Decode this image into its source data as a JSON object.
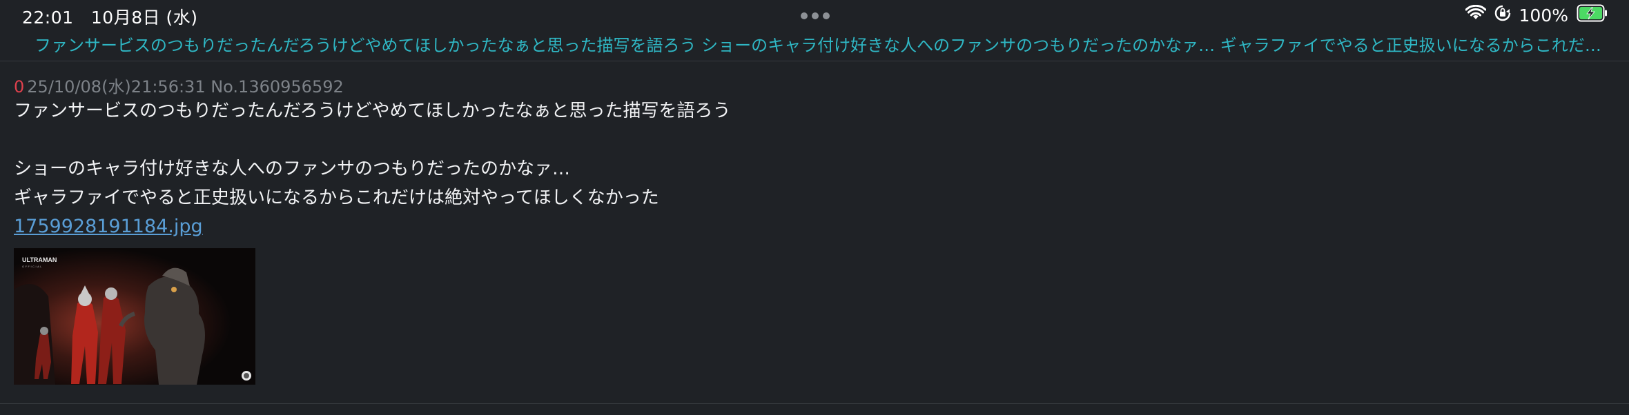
{
  "status_bar": {
    "time": "22:01",
    "date": "10月8日 (水)",
    "battery_percent": "100%",
    "icons": [
      "wifi-icon",
      "orientation-lock-icon",
      "battery-charging-icon"
    ]
  },
  "thread": {
    "title": "ファンサービスのつもりだったんだろうけどやめてほしかったなぁと思った描写を語ろう  ショーのキャラ付け好きな人へのファンサのつもりだったのかなァ… ギャラファイでやると正史扱いになるからこれだけは絶対やっ…"
  },
  "post": {
    "number": "0",
    "header": "25/10/08(水)21:56:31 No.1360956592",
    "body_lines": [
      "ファンサービスのつもりだったんだろうけどやめてほしかったなぁと思った描写を語ろう",
      "",
      "ショーのキャラ付け好きな人へのファンサのつもりだったのかなァ…",
      "ギャラファイでやると正史扱いになるからこれだけは絶対やってほしくなかった"
    ],
    "file_name": "1759928191184.jpg",
    "thumbnail": {
      "logo_text": "ULTRAMAN",
      "logo_sub": "OFFICIAL"
    }
  },
  "colors": {
    "background": "#1f2226",
    "title_accent": "#2fb7c4",
    "post_number": "#e0414d",
    "link": "#5a9ed6",
    "battery_green": "#4cd964"
  }
}
